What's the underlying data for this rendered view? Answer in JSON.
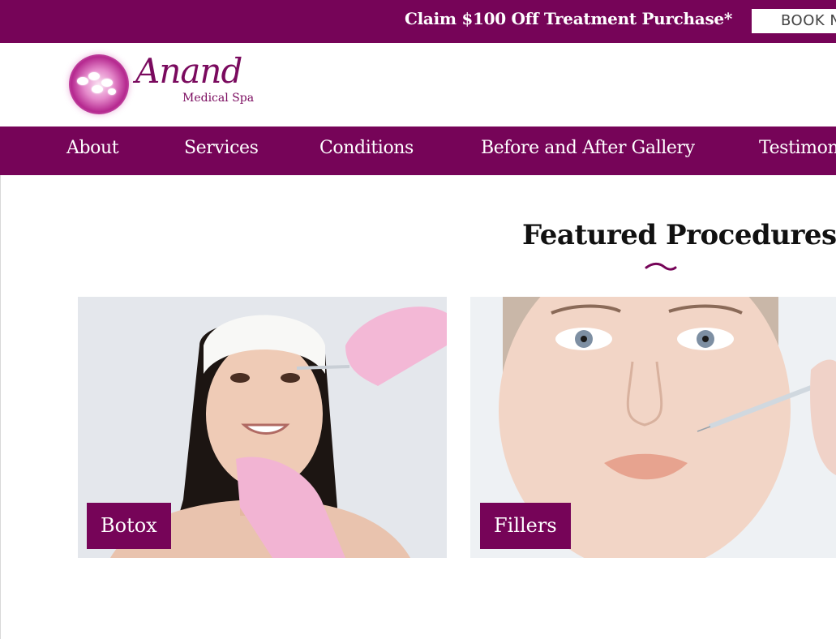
{
  "promo": {
    "text": "Claim $100 Off Treatment Purchase*",
    "button_label": "BOOK NOW"
  },
  "logo": {
    "name": "Anand",
    "subtitle": "Medical Spa"
  },
  "nav": {
    "items": [
      {
        "label": "About"
      },
      {
        "label": "Services"
      },
      {
        "label": "Conditions"
      },
      {
        "label": "Before and After Gallery"
      },
      {
        "label": "Testimonials"
      }
    ]
  },
  "featured": {
    "title": "Featured Procedures",
    "cards": [
      {
        "label": "Botox"
      },
      {
        "label": "Fillers"
      }
    ]
  },
  "colors": {
    "brand": "#760458",
    "text_dark": "#111111",
    "white": "#ffffff"
  }
}
